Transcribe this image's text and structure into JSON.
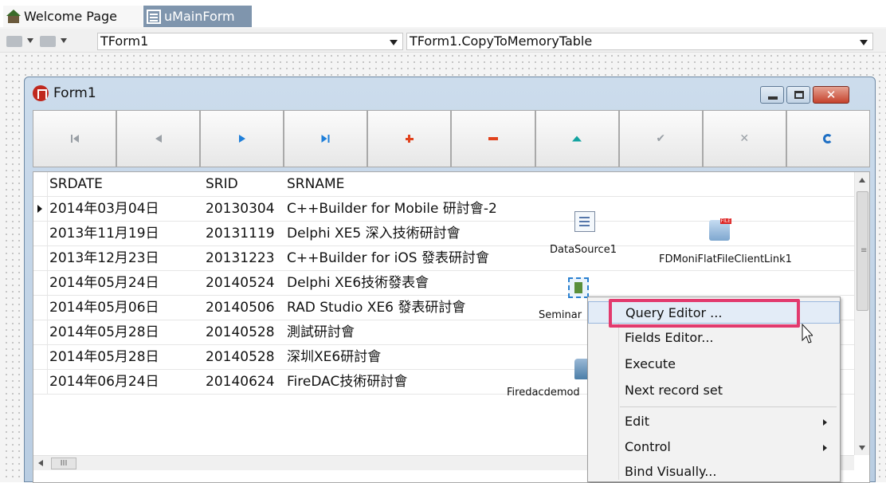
{
  "tabs": [
    {
      "label": "Welcome Page",
      "icon": "house-icon"
    },
    {
      "label": "uMainForm",
      "icon": "form-tab-icon"
    }
  ],
  "combos": {
    "class_combo": "TForm1",
    "method_combo": "TForm1.CopyToMemoryTable"
  },
  "form": {
    "title": "Form1",
    "navigator": [
      "first",
      "prior",
      "next",
      "last",
      "insert",
      "delete",
      "edit",
      "post",
      "cancel",
      "refresh"
    ]
  },
  "grid": {
    "columns": [
      "SRDATE",
      "SRID",
      "SRNAME"
    ],
    "rows": [
      [
        "2014年03月04日",
        "20130304",
        "C++Builder for Mobile 研討會-2"
      ],
      [
        "2013年11月19日",
        "20131119",
        "Delphi XE5 深入技術研討會"
      ],
      [
        "2013年12月23日",
        "20131223",
        "C++Builder for iOS 發表研討會"
      ],
      [
        "2014年05月24日",
        "20140524",
        "Delphi XE6技術發表會"
      ],
      [
        "2014年05月06日",
        "20140506",
        "RAD Studio XE6 發表研討會"
      ],
      [
        "2014年05月28日",
        "20140528",
        "測試研討會"
      ],
      [
        "2014年05月28日",
        "20140528",
        "深圳XE6研討會"
      ],
      [
        "2014年06月24日",
        "20140624",
        "FireDAC技術研討會"
      ]
    ],
    "current_row": 0,
    "hscroll_label": "III"
  },
  "components": {
    "datasource": "DataSource1",
    "filelink": "FDMoniFlatFileClientLink1",
    "query": "Seminar",
    "database": "Firedacdemod"
  },
  "context_menu": {
    "items": [
      {
        "label": "Query Editor ...",
        "selected": true
      },
      {
        "label": "Fields Editor..."
      },
      {
        "label": "Execute"
      },
      {
        "label": "Next record set"
      },
      {
        "label": "Edit",
        "submenu": true
      },
      {
        "label": "Control",
        "submenu": true
      },
      {
        "label": "Bind Visually..."
      }
    ]
  },
  "colors": {
    "highlight": "#e23a6e",
    "tab_active": "#7f95ad"
  }
}
